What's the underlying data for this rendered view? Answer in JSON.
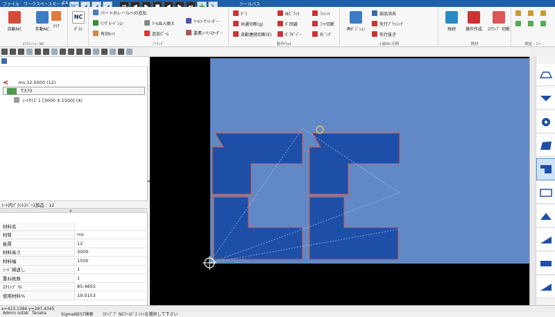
{
  "titlebar": {
    "tabs": [
      "ファイル",
      "ワークスペースモード",
      "CA"
    ],
    "context_tab": "ツールパス"
  },
  "ribbon": {
    "g1": {
      "btn_a": "自動NC",
      "btn_b": "手動NC",
      "btn_c": "ｸﾘｱ",
      "btn_d": "ﾎﾟｽﾄ",
      "label": "ｴｸｽﾃﾝｼｮﾝ NC",
      "nc_badge": "NC"
    },
    "g2": {
      "row1": "パートのレールへの追加",
      "row2": "ﾘﾝｸﾞﾙｰﾄﾞｼｮﾝ",
      "row2b": "ﾂｰﾙ出入換え",
      "row3": "有効ﾙｯﾄ",
      "row3b": "追加ｽﾞｰﾑ",
      "side": "ﾂｰﾙｼｰｹﾝｼｰﾀﾞｰ",
      "side2": "要素ｼｰｹﾝｽｶｰﾀﾞｰ",
      "label": "ﾂｰﾘﾝｸﾞ"
    },
    "g3": {
      "a": "ﾎﾞｽ",
      "b": "共通切断(g)",
      "c": "自動連続切断(E)",
      "d": "NCﾞﾗｯｸ",
      "e": "ﾎﾟ回避",
      "f": "ﾎﾞｱﾎﾞｿﾞｰ",
      "g": "ﾌｨﾚｯﾄ",
      "h": "ﾌｧｲ切断",
      "i": "ﾀﾋﾞﾝｸﾞ",
      "label": "動作Opt"
    },
    "g4": {
      "a": "再ﾎﾟｼﾞｼｮﾝ",
      "b": "部品消去",
      "c": "先行ﾌﾞﾗｯｼﾝｸﾞ",
      "d": "先行抜き",
      "label": "上級NC切断"
    },
    "g5": {
      "a": "残材",
      "b": "操作作成",
      "c": "ｽｸﾗｯﾌﾟ 切断",
      "label": "残材"
    },
    "g6": {
      "label": "検証 - ｴﾗｰ"
    }
  },
  "tree": {
    "root": "ms 12.0000 (12)",
    "machine": "T370",
    "sheet": "ｼｰﾄｻｲｽﾞ1 [3000 X 1500] (4)"
  },
  "part_count_label": "ｼｰﾄ内ﾌﾟﾗｯﾄｽﾍﾟｰｽ部品 : 12",
  "properties": [
    {
      "key": "材料名",
      "value": ""
    },
    {
      "key": "材質",
      "value": "ms"
    },
    {
      "key": "板厚",
      "value": "12"
    },
    {
      "key": "材料長さ",
      "value": "3000"
    },
    {
      "key": "材料幅",
      "value": "1500"
    },
    {
      "key": "ｼｰﾄﾞ繰返し",
      "value": "1"
    },
    {
      "key": "重ね枚数",
      "value": "1"
    },
    {
      "key": "ｽｸﾗｯﾌﾟ %",
      "value": "85.4855"
    },
    {
      "key": "使用材料%",
      "value": "19.0153"
    }
  ],
  "statusbar": {
    "coords": "x=423.1384 y=287.4345",
    "tab1": "Admin sotak",
    "tab2": "Tanaka",
    "tab3": "SigmaNEST検索",
    "message": "ｽﾃｯﾌﾟﾌﾞ NCﾂｰﾙﾊﾟｽ ｼｬﾝを選択して下さい"
  },
  "colors": {
    "sheet": "#6189c8",
    "part": "#1d4fa8",
    "part_outline": "#e8563a",
    "ribbon_accent": "#1e5fa8"
  }
}
